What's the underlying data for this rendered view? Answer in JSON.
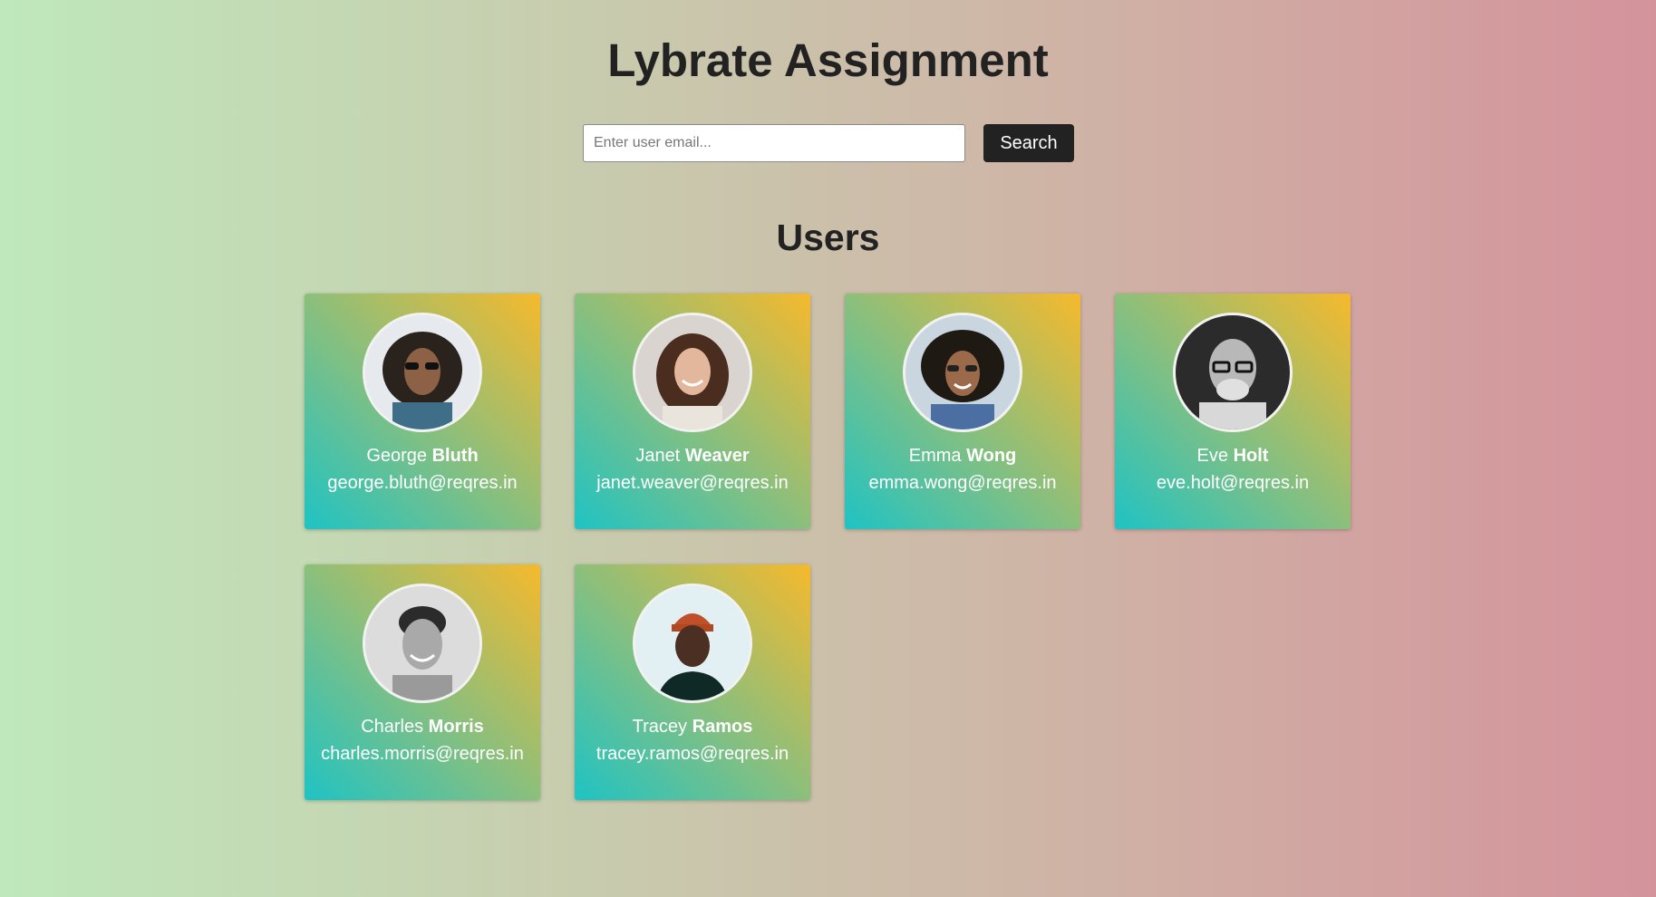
{
  "page": {
    "title": "Lybrate Assignment",
    "section_title": "Users"
  },
  "search": {
    "placeholder": "Enter user email...",
    "value": "",
    "button_label": "Search"
  },
  "users": [
    {
      "first_name": "George",
      "last_name": "Bluth",
      "email": "george.bluth@reqres.in"
    },
    {
      "first_name": "Janet",
      "last_name": "Weaver",
      "email": "janet.weaver@reqres.in"
    },
    {
      "first_name": "Emma",
      "last_name": "Wong",
      "email": "emma.wong@reqres.in"
    },
    {
      "first_name": "Eve",
      "last_name": "Holt",
      "email": "eve.holt@reqres.in"
    },
    {
      "first_name": "Charles",
      "last_name": "Morris",
      "email": "charles.morris@reqres.in"
    },
    {
      "first_name": "Tracey",
      "last_name": "Ramos",
      "email": "tracey.ramos@reqres.in"
    }
  ],
  "colors": {
    "card_gradient_start": "#1fc3c4",
    "card_gradient_mid": "#8cbf7c",
    "card_gradient_end": "#f6b92c",
    "button_bg": "#222222",
    "text_dark": "#222222"
  }
}
